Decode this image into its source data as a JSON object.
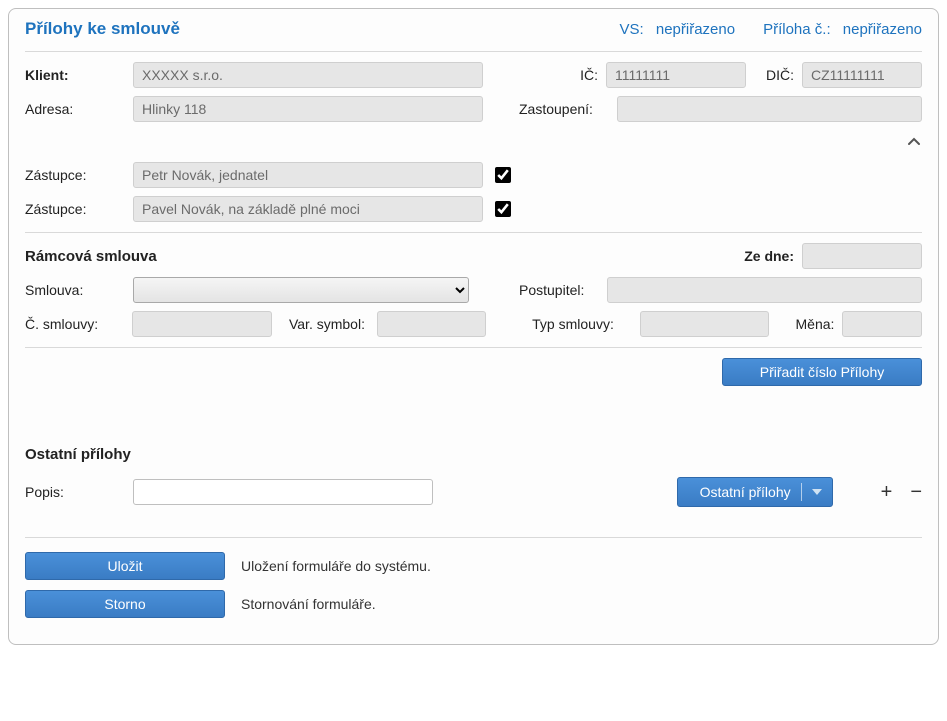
{
  "header": {
    "title": "Přílohy ke smlouvě",
    "vs_label": "VS:",
    "vs_value": "nepřiřazeno",
    "priloha_label": "Příloha č.:",
    "priloha_value": "nepřiřazeno"
  },
  "klient": {
    "label": "Klient:",
    "value": "XXXXX s.r.o.",
    "ic_label": "IČ:",
    "ic_value": "11111111",
    "dic_label": "DIČ:",
    "dic_value": "CZ11111111"
  },
  "adresa": {
    "label": "Adresa:",
    "value": "Hlinky 118",
    "zastoupeni_label": "Zastoupení:",
    "zastoupeni_value": ""
  },
  "zastupci": [
    {
      "label": "Zástupce:",
      "value": "Petr Novák, jednatel",
      "checked": true
    },
    {
      "label": "Zástupce:",
      "value": "Pavel Novák, na základě plné moci",
      "checked": true
    }
  ],
  "ramcova": {
    "title": "Rámcová smlouva",
    "ze_dne_label": "Ze dne:",
    "ze_dne_value": "",
    "smlouva_label": "Smlouva:",
    "smlouva_value": "",
    "postupitel_label": "Postupitel:",
    "postupitel_value": "",
    "c_smlouvy_label": "Č. smlouvy:",
    "c_smlouvy_value": "",
    "var_symbol_label": "Var. symbol:",
    "var_symbol_value": "",
    "typ_smlouvy_label": "Typ smlouvy:",
    "typ_smlouvy_value": "",
    "mena_label": "Měna:",
    "mena_value": ""
  },
  "assign_btn": "Přiřadit číslo Přílohy",
  "ostatni": {
    "title": "Ostatní přílohy",
    "popis_label": "Popis:",
    "popis_value": "",
    "dropdown_label": "Ostatní přílohy"
  },
  "footer": {
    "save_label": "Uložit",
    "save_desc": "Uložení formuláře do systému.",
    "cancel_label": "Storno",
    "cancel_desc": "Stornování formuláře."
  }
}
